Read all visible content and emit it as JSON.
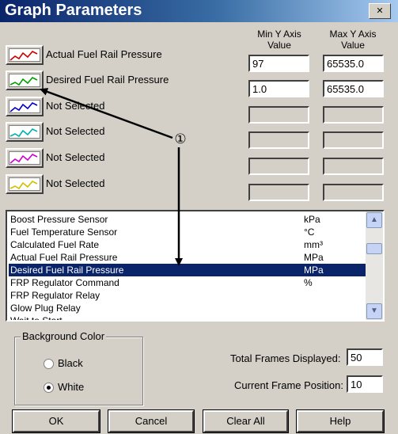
{
  "window": {
    "title": "Graph Parameters"
  },
  "columns": {
    "min_header": "Min Y  Axis\nValue",
    "max_header": "Max Y  Axis\nValue"
  },
  "parameters": [
    {
      "label": "Actual Fuel Rail Pressure",
      "min": "97",
      "max": "65535.0",
      "color": "#cc0000",
      "enabled": true
    },
    {
      "label": "Desired Fuel Rail Pressure",
      "min": "1.0",
      "max": "65535.0",
      "color": "#00a000",
      "enabled": true
    },
    {
      "label": "Not Selected",
      "min": "",
      "max": "",
      "color": "#0000cc",
      "enabled": false
    },
    {
      "label": "Not Selected",
      "min": "",
      "max": "",
      "color": "#00b0b0",
      "enabled": false
    },
    {
      "label": "Not Selected",
      "min": "",
      "max": "",
      "color": "#d000d0",
      "enabled": false
    },
    {
      "label": "Not Selected",
      "min": "",
      "max": "",
      "color": "#d0c000",
      "enabled": false
    }
  ],
  "sensor_list": [
    {
      "name": "Boost Pressure Sensor",
      "unit": "kPa"
    },
    {
      "name": "Fuel Temperature Sensor",
      "unit": "°C"
    },
    {
      "name": "Calculated Fuel Rate",
      "unit": "mm³"
    },
    {
      "name": "Actual Fuel Rail Pressure",
      "unit": "MPa"
    },
    {
      "name": "Desired Fuel Rail Pressure",
      "unit": "MPa",
      "selected": true
    },
    {
      "name": "FRP Regulator Command",
      "unit": "%"
    },
    {
      "name": "FRP Regulator Relay",
      "unit": ""
    },
    {
      "name": "Glow Plug Relay",
      "unit": ""
    },
    {
      "name": "Wait to Start",
      "unit": ""
    }
  ],
  "callout": {
    "marker": "①"
  },
  "background_color": {
    "title": "Background Color",
    "options": [
      "Black",
      "White"
    ],
    "selected": "White"
  },
  "frames": {
    "total_label": "Total Frames Displayed:",
    "total_value": "50",
    "current_label": "Current Frame Position:",
    "current_value": "10"
  },
  "buttons": {
    "ok": "OK",
    "cancel": "Cancel",
    "clear_all": "Clear All",
    "help": "Help"
  }
}
